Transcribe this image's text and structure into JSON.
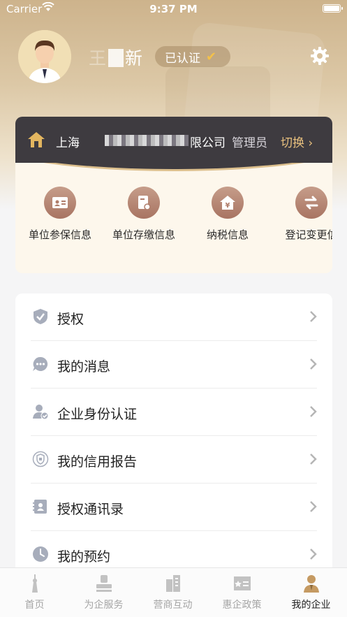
{
  "status_bar": {
    "carrier": "Carrier",
    "time": "9:37 PM"
  },
  "profile": {
    "name": "新",
    "name_prefix": "王",
    "certified_label": "已认证"
  },
  "company": {
    "name_prefix": "上海",
    "name_suffix": "限公司",
    "role": "管理员",
    "switch_label": "切换 ›"
  },
  "services": [
    {
      "label": "单位参保信息",
      "icon": "id-card-icon"
    },
    {
      "label": "单位存缴信息",
      "icon": "document-icon"
    },
    {
      "label": "纳税信息",
      "icon": "tax-house-icon"
    },
    {
      "label": "登记变更信",
      "icon": "exchange-icon"
    }
  ],
  "menu": [
    {
      "label": "授权",
      "icon": "shield-check-icon"
    },
    {
      "label": "我的消息",
      "icon": "chat-bubble-icon"
    },
    {
      "label": "企业身份认证",
      "icon": "user-verify-icon"
    },
    {
      "label": "我的信用报告",
      "icon": "credit-badge-icon"
    },
    {
      "label": "授权通讯录",
      "icon": "contacts-icon"
    },
    {
      "label": "我的预约",
      "icon": "clock-icon"
    }
  ],
  "tabs": [
    {
      "label": "首页",
      "icon": "tower-icon",
      "active": false
    },
    {
      "label": "为企服务",
      "icon": "stamp-icon",
      "active": false
    },
    {
      "label": "营商互动",
      "icon": "buildings-icon",
      "active": false
    },
    {
      "label": "惠企政策",
      "icon": "policy-card-icon",
      "active": false
    },
    {
      "label": "我的企业",
      "icon": "user-profile-icon",
      "active": true
    }
  ],
  "colors": {
    "header_gold": "#cdb38c",
    "dark_bar": "#3e3b40",
    "accent_gold": "#e8c07e",
    "service_icon": "#b07d6b",
    "menu_icon": "#a7adbb"
  }
}
